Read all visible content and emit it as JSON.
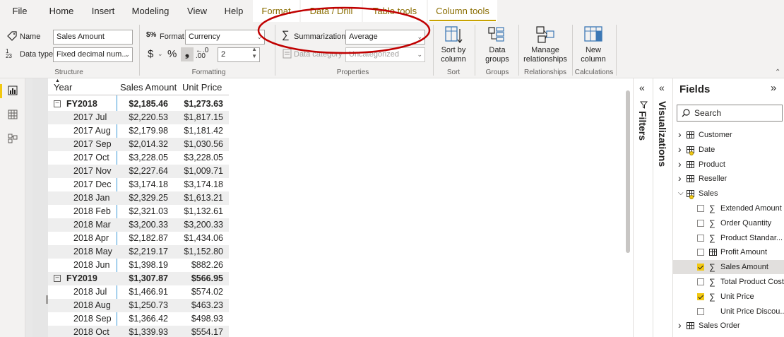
{
  "menu": {
    "tabs": [
      "File",
      "Home",
      "Insert",
      "Modeling",
      "View",
      "Help",
      "Format",
      "Data / Drill",
      "Table tools",
      "Column tools"
    ]
  },
  "ribbon": {
    "name_label": "Name",
    "name_value": "Sales Amount",
    "datatype_label": "Data type",
    "datatype_value": "Fixed decimal num...",
    "structure_group": "Structure",
    "format_label": "Format",
    "format_value": "Currency",
    "decimals_value": "2",
    "formatting_group": "Formatting",
    "summarization_label": "Summarization",
    "summarization_value": "Average",
    "datacategory_label": "Data category",
    "datacategory_value": "Uncategorized",
    "properties_group": "Properties",
    "sortby_label": "Sort by column",
    "sort_group": "Sort",
    "datagroups_label": "Data groups",
    "groups_group": "Groups",
    "managerel_label": "Manage relationships",
    "relationships_group": "Relationships",
    "newcol_label": "New column",
    "calculations_group": "Calculations"
  },
  "table": {
    "headers": [
      "Year",
      "Sales Amount",
      "Unit Price"
    ],
    "rows": [
      {
        "label": "FY2018",
        "sales": "$2,185.46",
        "price": "$1,273.63",
        "fy": true
      },
      {
        "label": "2017 Jul",
        "sales": "$2,220.53",
        "price": "$1,817.15"
      },
      {
        "label": "2017 Aug",
        "sales": "$2,179.98",
        "price": "$1,181.42"
      },
      {
        "label": "2017 Sep",
        "sales": "$2,014.32",
        "price": "$1,030.56"
      },
      {
        "label": "2017 Oct",
        "sales": "$3,228.05",
        "price": "$3,228.05"
      },
      {
        "label": "2017 Nov",
        "sales": "$2,227.64",
        "price": "$1,009.71"
      },
      {
        "label": "2017 Dec",
        "sales": "$3,174.18",
        "price": "$3,174.18"
      },
      {
        "label": "2018 Jan",
        "sales": "$2,329.25",
        "price": "$1,613.21"
      },
      {
        "label": "2018 Feb",
        "sales": "$2,321.03",
        "price": "$1,132.61"
      },
      {
        "label": "2018 Mar",
        "sales": "$3,200.33",
        "price": "$3,200.33"
      },
      {
        "label": "2018 Apr",
        "sales": "$2,182.87",
        "price": "$1,434.06"
      },
      {
        "label": "2018 May",
        "sales": "$2,219.17",
        "price": "$1,152.80"
      },
      {
        "label": "2018 Jun",
        "sales": "$1,398.19",
        "price": "$882.26"
      },
      {
        "label": "FY2019",
        "sales": "$1,307.87",
        "price": "$566.95",
        "fy": true
      },
      {
        "label": "2018 Jul",
        "sales": "$1,466.91",
        "price": "$574.02"
      },
      {
        "label": "2018 Aug",
        "sales": "$1,250.73",
        "price": "$463.23"
      },
      {
        "label": "2018 Sep",
        "sales": "$1,366.42",
        "price": "$498.93"
      },
      {
        "label": "2018 Oct",
        "sales": "$1,339.93",
        "price": "$554.17"
      }
    ]
  },
  "panes": {
    "filters": "Filters",
    "visualizations": "Visualizations",
    "fields_title": "Fields",
    "search_placeholder": "Search"
  },
  "fields": [
    {
      "label": "Customer",
      "kind": "table",
      "expanded": false
    },
    {
      "label": "Date",
      "kind": "table-gear",
      "expanded": false
    },
    {
      "label": "Product",
      "kind": "table",
      "expanded": false
    },
    {
      "label": "Reseller",
      "kind": "table",
      "expanded": false
    },
    {
      "label": "Sales",
      "kind": "table-gear",
      "expanded": true
    },
    {
      "label": "Extended Amount",
      "kind": "sigma",
      "checked": false
    },
    {
      "label": "Order Quantity",
      "kind": "sigma",
      "checked": false
    },
    {
      "label": "Product Standar...",
      "kind": "sigma",
      "checked": false
    },
    {
      "label": "Profit Amount",
      "kind": "calc",
      "checked": false
    },
    {
      "label": "Sales Amount",
      "kind": "sigma",
      "checked": true,
      "selected": true
    },
    {
      "label": "Total Product Cost",
      "kind": "sigma",
      "checked": false
    },
    {
      "label": "Unit Price",
      "kind": "sigma",
      "checked": true
    },
    {
      "label": "Unit Price Discou...",
      "kind": "none",
      "checked": false
    },
    {
      "label": "Sales Order",
      "kind": "table",
      "expanded": false
    }
  ],
  "colors": {
    "accent": "#f2c811",
    "annotation": "#c00000"
  }
}
